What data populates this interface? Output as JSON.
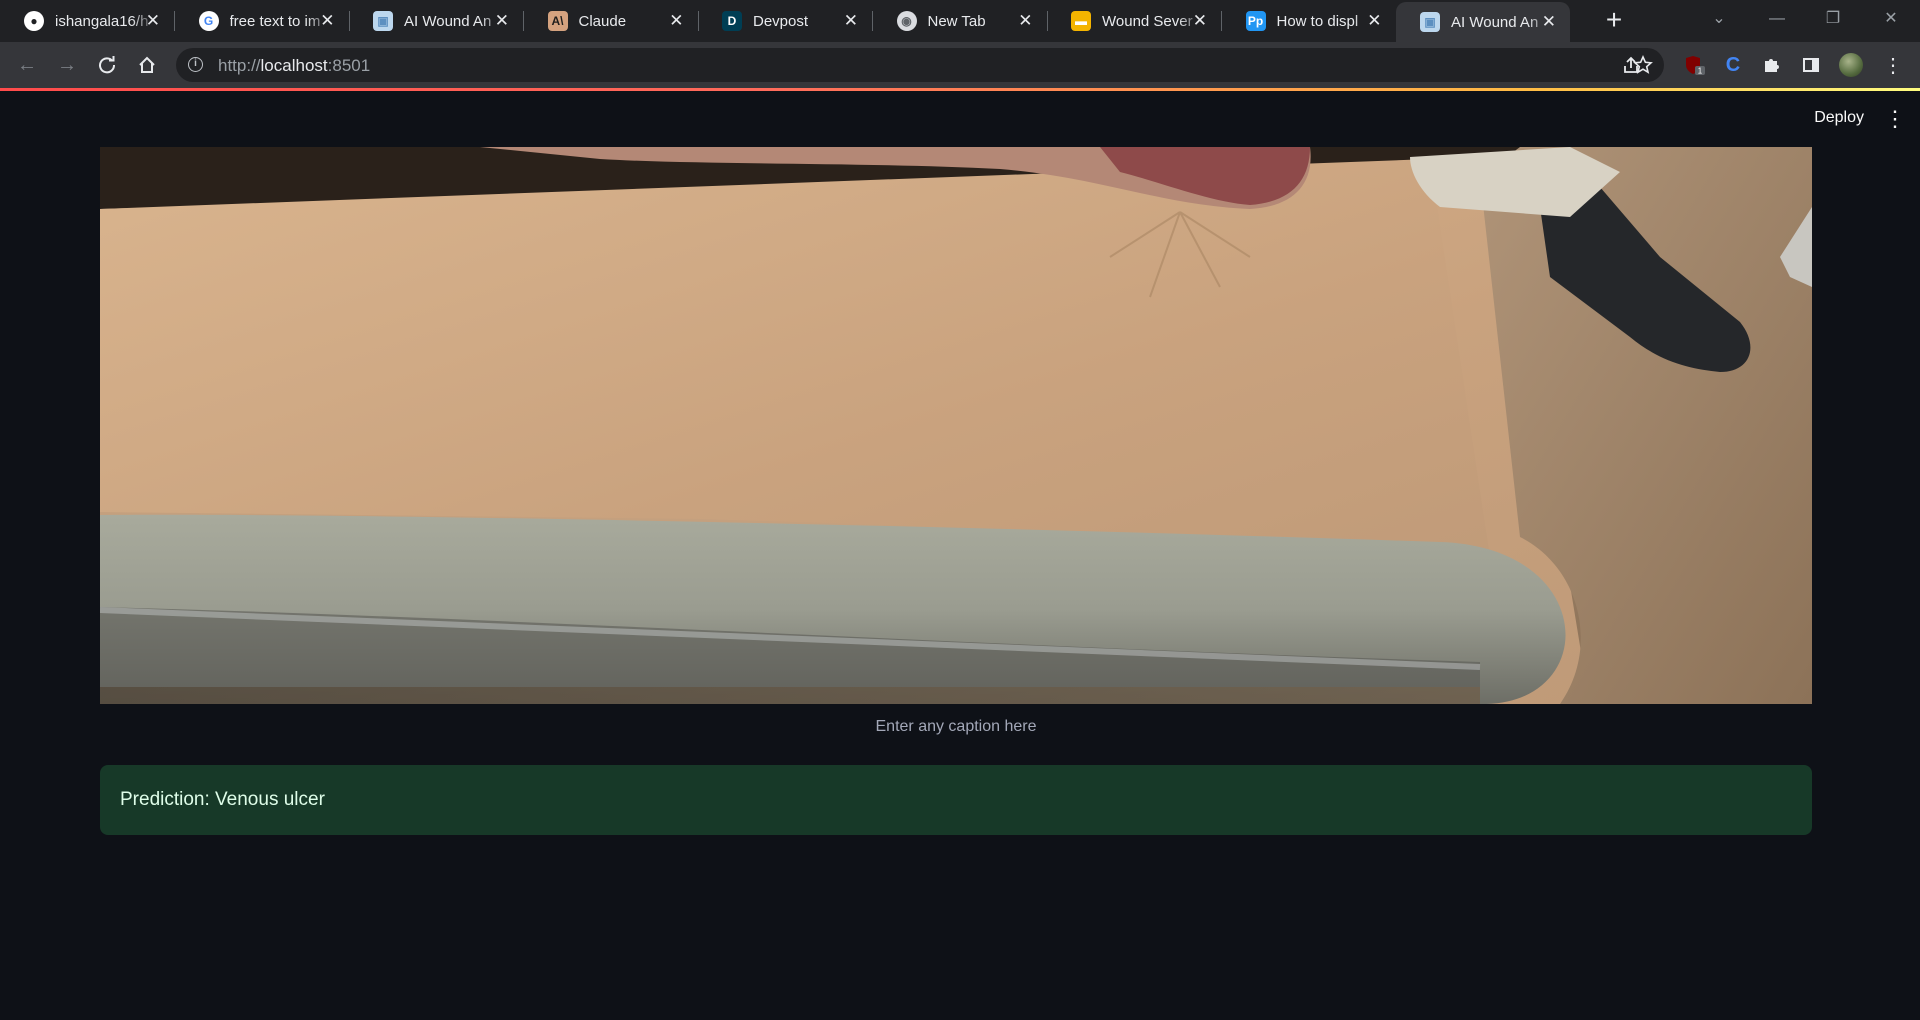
{
  "browser": {
    "tabs": [
      {
        "title": "ishangala16/h",
        "icon": "github-icon",
        "favicon_bg": "#ffffff",
        "favicon_fg": "#202124",
        "glyph": "●",
        "active": false
      },
      {
        "title": "free text to im",
        "icon": "google-icon",
        "favicon_bg": "#ffffff",
        "favicon_fg": "#4285f4",
        "glyph": "G",
        "active": false
      },
      {
        "title": "AI Wound An",
        "icon": "cube-icon",
        "favicon_bg": "#bcd7ee",
        "favicon_fg": "#5c8fc0",
        "glyph": "▣",
        "active": false
      },
      {
        "title": "Claude",
        "icon": "anthropic-icon",
        "favicon_bg": "#d4a27f",
        "favicon_fg": "#1f1e1d",
        "glyph": "A\\",
        "active": false
      },
      {
        "title": "Devpost",
        "icon": "devpost-icon",
        "favicon_bg": "#003e54",
        "favicon_fg": "#ffffff",
        "glyph": "D",
        "active": false
      },
      {
        "title": "New Tab",
        "icon": "chrome-icon",
        "favicon_bg": "#dadce0",
        "favicon_fg": "#5f6368",
        "glyph": "◉",
        "active": false
      },
      {
        "title": "Wound Sever",
        "icon": "slides-icon",
        "favicon_bg": "#f4b400",
        "favicon_fg": "#ffffff",
        "glyph": "▬",
        "active": false
      },
      {
        "title": "How to displ",
        "icon": "pp-icon",
        "favicon_bg": "#2196f3",
        "favicon_fg": "#ffffff",
        "glyph": "Pp",
        "active": false
      },
      {
        "title": "AI Wound An",
        "icon": "cube-icon",
        "favicon_bg": "#bcd7ee",
        "favicon_fg": "#5c8fc0",
        "glyph": "▣",
        "active": true
      }
    ],
    "url_scheme": "http://",
    "url_host": "localhost",
    "url_port": ":8501",
    "extension_badge": "1"
  },
  "app": {
    "deploy_label": "Deploy",
    "image_caption": "Enter any caption here",
    "prediction_text": "Prediction: Venous ulcer",
    "success_bg": "#173928",
    "accent": "#ff4b4b"
  }
}
